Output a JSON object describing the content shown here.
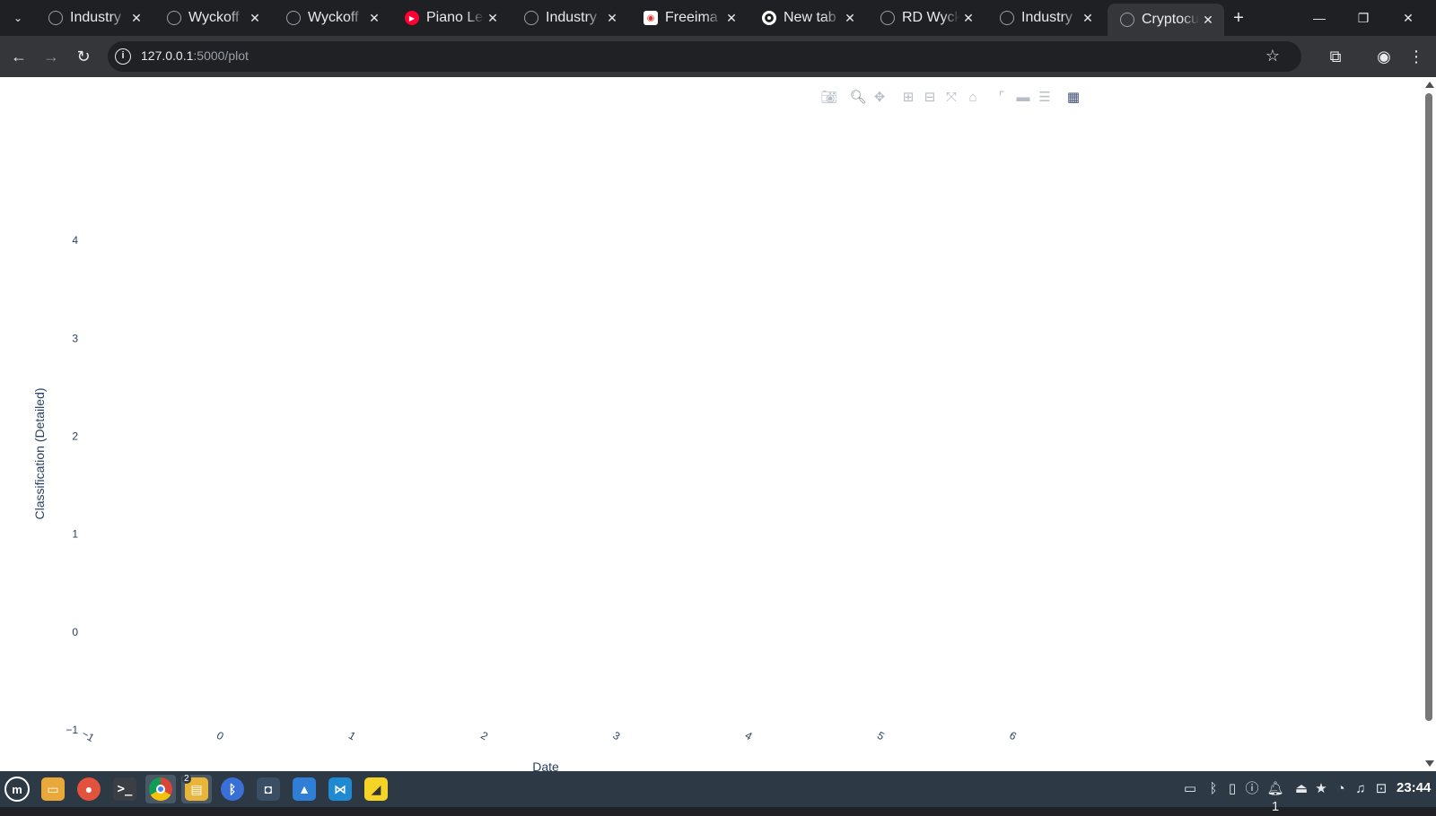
{
  "browser": {
    "tabs": [
      {
        "title": "Industry",
        "favicon": "globe-icon",
        "active": false
      },
      {
        "title": "Wyckoff",
        "favicon": "globe-icon",
        "active": false
      },
      {
        "title": "Wyckoff",
        "favicon": "globe-icon",
        "active": false
      },
      {
        "title": "Piano Le",
        "favicon": "youtube-icon",
        "active": false
      },
      {
        "title": "Industry",
        "favicon": "globe-icon",
        "active": false
      },
      {
        "title": "Freeima",
        "favicon": "freeimage-icon",
        "active": false
      },
      {
        "title": "New tab",
        "favicon": "chrome-icon",
        "active": false
      },
      {
        "title": "RD Wyck",
        "favicon": "globe-icon",
        "active": false
      },
      {
        "title": "Industry",
        "favicon": "globe-icon",
        "active": false
      },
      {
        "title": "Cryptocu",
        "favicon": "globe-icon",
        "active": true
      }
    ],
    "address": {
      "host": "127.0.0.1",
      "path": ":5000/plot"
    },
    "accent": "#35363a"
  },
  "plot": {
    "modebar": [
      "camera-icon",
      "zoom-icon",
      "pan-icon",
      "zoom-in-icon",
      "zoom-out-icon",
      "autoscale-icon",
      "reset-axes-icon",
      "spike-lines-icon",
      "hover-closest-icon",
      "hover-compare-icon",
      "plotly-logo-icon"
    ]
  },
  "chart_data": {
    "type": "scatter",
    "series": [],
    "xlabel": "Date",
    "ylabel": "Classification (Detailed)",
    "x_ticks": [
      -1,
      0,
      1,
      2,
      3,
      4,
      5,
      6
    ],
    "y_ticks": [
      -1,
      0,
      1,
      2,
      3,
      4
    ],
    "xlim": [
      -1,
      6.05
    ],
    "ylim": [
      -1,
      4.9
    ],
    "grid": false,
    "tick_color": "#2a3f5f"
  },
  "taskbar": {
    "apps": [
      "mint-menu-icon",
      "files-icon",
      "firefox-icon",
      "terminal-icon",
      "chrome-icon",
      "file-manager-icon",
      "bluetooth-icon",
      "software-icon",
      "image-viewer-icon",
      "vscode-icon",
      "sticky-notes-icon"
    ],
    "file_manager_badge": "2",
    "notification_count": "1",
    "clock": "23:44"
  }
}
